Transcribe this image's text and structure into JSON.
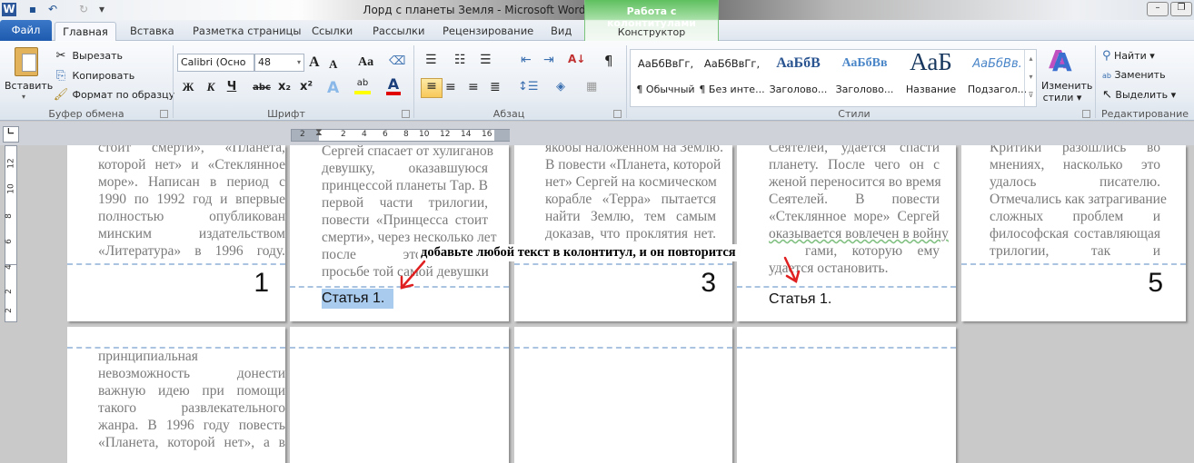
{
  "window": {
    "title": "Лорд с планеты Земля  -  Microsoft Word",
    "context_tab_group": "Работа с колонтитулами",
    "context_tab": "Конструктор"
  },
  "qat": {
    "app_icon": "word-icon",
    "save_icon": "save-icon",
    "undo_icon": "undo-icon",
    "redo_icon": "redo-icon",
    "customize_icon": "customize-icon"
  },
  "tabs": {
    "file": "Файл",
    "items": [
      "Главная",
      "Вставка",
      "Разметка страницы",
      "Ссылки",
      "Рассылки",
      "Рецензирование",
      "Вид"
    ],
    "active": "Главная"
  },
  "clipboard": {
    "label": "Буфер обмена",
    "paste": "Вставить",
    "cut": "Вырезать",
    "copy": "Копировать",
    "format_painter": "Формат по образцу"
  },
  "font": {
    "label": "Шрифт",
    "name": "Calibri (Осно",
    "size": "48",
    "bold": "Ж",
    "italic": "К",
    "underline": "Ч",
    "strike": "abc",
    "sub": "x₂",
    "sup": "x²",
    "grow": "A",
    "shrink": "A",
    "case": "Aa",
    "highlight_color": "#ffff00",
    "font_color": "#e00000"
  },
  "paragraph": {
    "label": "Абзац",
    "pilcrow": "¶"
  },
  "styles": {
    "label": "Стили",
    "change": "Изменить",
    "change2": "стили",
    "items": [
      {
        "sample": "АаБбВвГг,",
        "name": "¶ Обычный"
      },
      {
        "sample": "АаБбВвГг,",
        "name": "¶ Без инте..."
      },
      {
        "sample": "АаБбВ",
        "name": "Заголово..."
      },
      {
        "sample": "АаБбВв",
        "name": "Заголово..."
      },
      {
        "sample": "АаБ",
        "name": "Название"
      },
      {
        "sample": "АаБбВв.",
        "name": "Подзагол..."
      }
    ]
  },
  "editing": {
    "label": "Редактирование",
    "find": "Найти",
    "replace": "Заменить",
    "select": "Выделить"
  },
  "ruler": {
    "h": [
      "2",
      "2",
      "4",
      "6",
      "8",
      "10",
      "12",
      "14",
      "16"
    ],
    "v": [
      "12",
      "10",
      "8",
      "6",
      "4",
      "2",
      "2"
    ]
  },
  "pages": [
    {
      "lines": [
        "стоит смерти», «Планета,",
        "которой нет» и «Стеклянное",
        "море». Написан в период с",
        "1990 по 1992 год и впервые",
        "полностью опубликован",
        "минским издательством",
        "«Литература» в 1996 году."
      ],
      "number": "1"
    },
    {
      "lines": [
        "Сергей спасает от хулиганов",
        "девушку, оказавшуюся",
        "принцессой планеты Тар. В",
        "первой части трилогии,",
        "повести «Принцесса стоит",
        "смерти», через несколько лет",
        "после этого с",
        "просьбе той самой девушки"
      ],
      "header": "Статья 1."
    },
    {
      "lines": [
        "якобы наложенном на Землю.",
        "В повести «Планета, которой",
        "нет» Сергей на космическом",
        "корабле «Терра» пытается",
        "найти Землю, тем самым",
        "доказав, что проклятия нет."
      ],
      "number": "3"
    },
    {
      "lines": [
        "Сеятелей, удается спасти",
        "планету. После чего он с",
        "женой переносится во время",
        "Сеятелей. В повести",
        "«Стеклянное море» Сергей",
        "оказывается вовлечен в войну",
        "гами, которую ему",
        "удается остановить."
      ],
      "header": "Статья 1."
    },
    {
      "lines": [
        "Критики разошлись во",
        "мнениях, насколько это",
        "удалось писателю.",
        "Отмечались как затрагивание",
        "сложных проблем и",
        "философская составляющая",
        "трилогии, так и"
      ],
      "number": "5"
    },
    {
      "lines": [
        "принципиальная",
        "невозможность донести",
        "важную идею при помощи",
        "такого развлекательного",
        "жанра. В 1996 году повесть",
        "«Планета, которой нет», а в"
      ]
    }
  ],
  "annotation": {
    "text": "добавьте любой текст в колонтитул, и он повторится",
    "arrow_color": "#e02020"
  }
}
